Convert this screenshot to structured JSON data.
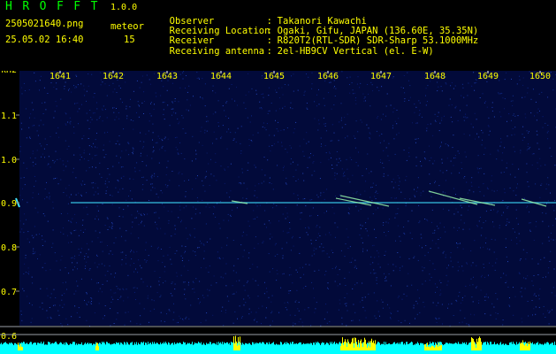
{
  "app": {
    "title": "HROFFT",
    "version": "1.0.0",
    "file_name": "2505021640.png",
    "timestamp": "25.05.02 16:40",
    "meteor_label": "meteor",
    "meteor_count": "15"
  },
  "info": [
    {
      "key": "Observer",
      "sep": ":",
      "value": "Takanori Kawachi"
    },
    {
      "key": "Receiving Location",
      "sep": ":",
      "value": "Ogaki, Gifu, JAPAN (136.60E, 35.35N)"
    },
    {
      "key": "Receiver",
      "sep": ":",
      "value": "R820T2(RTL-SDR) SDR-Sharp 53.1000MHz"
    },
    {
      "key": "Receiving antenna",
      "sep": ":",
      "value": "2el-HB9CV Vertical (el. E-W)"
    }
  ],
  "axes": {
    "y_unit": "kHz",
    "y_ticks": [
      "1.1",
      "1.0",
      "0.9",
      "0.8",
      "0.7",
      "0.6"
    ],
    "x_ticks": [
      "1641",
      "1642",
      "1643",
      "1644",
      "1645",
      "1646",
      "1647",
      "1648",
      "1649",
      "1650"
    ]
  },
  "colors": {
    "background": "#000000",
    "header_text": "#ffff00",
    "title_text": "#00ff00",
    "axis_labels": "#ffff00",
    "spectrogram_noise": "#0a1a6a",
    "signal": "#40e0ff",
    "power_trace": "#00ffff",
    "power_peaks": "#ffff00"
  }
}
